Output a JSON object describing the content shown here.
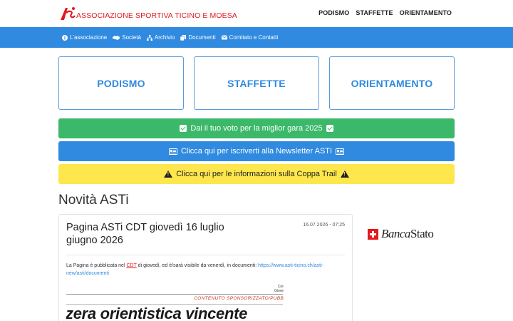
{
  "header": {
    "logo_text": "ASSOCIAZIONE SPORTIVA TICINO E MOESA",
    "nav": [
      "PODISMO",
      "STAFFETTE",
      "ORIENTAMENTO"
    ]
  },
  "subnav": {
    "items": [
      {
        "label": "L'associazione",
        "icon": "info-circle-icon"
      },
      {
        "label": "Società",
        "icon": "handshake-icon"
      },
      {
        "label": "Archivio",
        "icon": "sitemap-icon"
      },
      {
        "label": "Documenti",
        "icon": "copy-icon"
      },
      {
        "label": "Comitato e Contatti",
        "icon": "envelope-icon"
      }
    ]
  },
  "boxes": [
    "PODISMO",
    "STAFFETTE",
    "ORIENTAMENTO"
  ],
  "banners": {
    "vote": "Dai il tuo voto per la miglior gara 2025",
    "newsletter": "Clicca qui per iscriverti alla Newsletter ASTI",
    "coppa": "Clicca qui per le informazioni sulla Coppa Trail"
  },
  "section_title": "Novità ASTi",
  "card": {
    "title": "Pagina ASTi CDT giovedì 16 luglio giugno 2026",
    "date": "16.07.2026 - 07:25",
    "text_before": "La Pagina è pubblicata nel ",
    "text_cdt": "CDT",
    "text_after": " di giovedì, ed è/sarà visibile da venerdì, in documenti: ",
    "link": "https://www.asti-ticino.ch/asti-new/asti/documenti",
    "clip_tag": "CONTENUTO SPONSORIZZATO/PUBB",
    "clip_tiny": "Cor\nGiove",
    "clip_headline": "zera orientistica vincente"
  },
  "sponsor": {
    "part1": "Banca",
    "part2": "Stato"
  },
  "colors": {
    "brand_red": "#e3191d",
    "brand_blue": "#2f8ae0",
    "green": "#3cb86a",
    "yellow": "#fde74c"
  }
}
